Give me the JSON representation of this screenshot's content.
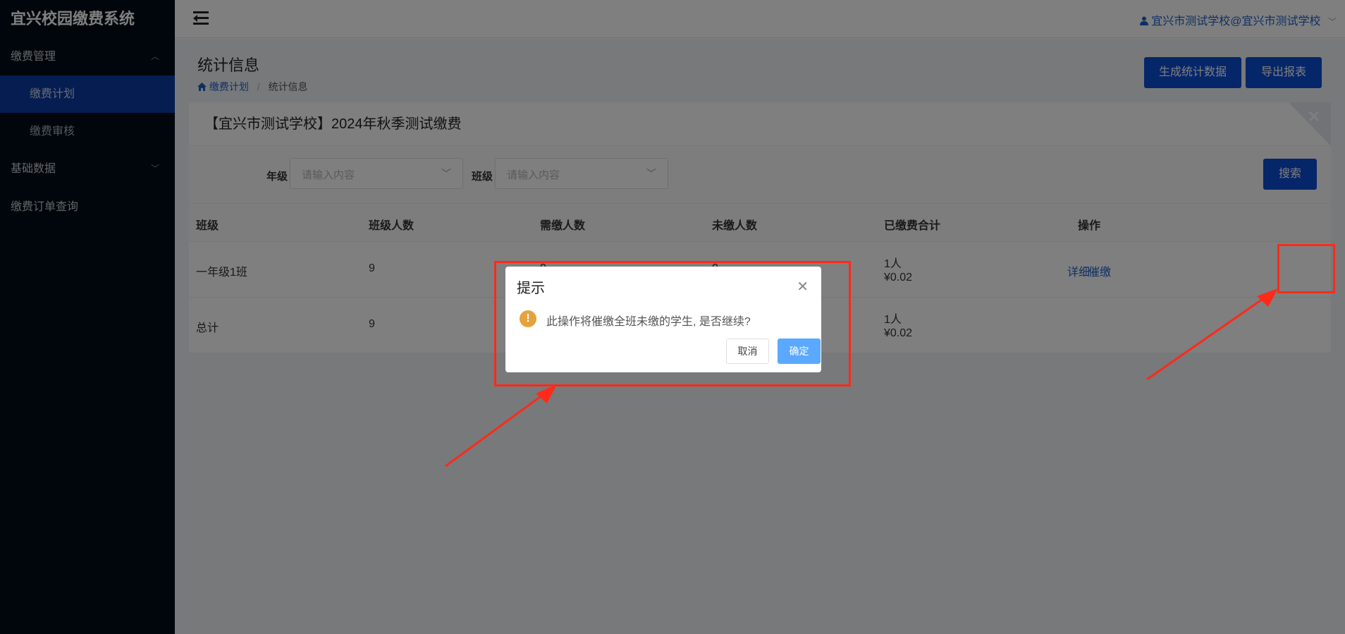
{
  "app": {
    "title": "宜兴校园缴费系统"
  },
  "sidebar": {
    "groups": [
      {
        "label": "缴费管理",
        "chevron": "︿"
      },
      {
        "label": "基础数据",
        "chevron": "﹀"
      }
    ],
    "sub_items": [
      "缴费计划",
      "缴费审核"
    ],
    "plain_item": "缴费订单查询"
  },
  "header": {
    "user_label": "宜兴市测试学校@宜兴市测试学校",
    "user_icon": "user-icon"
  },
  "page": {
    "title": "统计信息",
    "breadcrumb": {
      "home": "缴费计划",
      "current": "统计信息",
      "sep": "/"
    },
    "buttons": {
      "generate": "生成统计数据",
      "export": "导出报表"
    }
  },
  "card": {
    "title": "【宜兴市测试学校】2024年秋季测试缴费"
  },
  "filters": {
    "grade_label": "年级",
    "grade_placeholder": "请输入内容",
    "class_label": "班级",
    "class_placeholder": "请输入内容",
    "search_button": "搜索"
  },
  "table": {
    "headers": [
      "班级",
      "班级人数",
      "需缴人数",
      "未缴人数",
      "已缴费合计",
      "操作"
    ],
    "rows": [
      {
        "class": "一年级1班",
        "count": "9",
        "need": "0",
        "unpaid": "0",
        "paid_people": "1人",
        "paid_amount": "¥0.02",
        "action_detail": "详细",
        "action_remind": "催缴"
      },
      {
        "class": "总计",
        "count": "9",
        "need": "",
        "unpaid": "",
        "paid_people": "1人",
        "paid_amount": "¥0.02"
      }
    ]
  },
  "dialog": {
    "title": "提示",
    "message": "此操作将催缴全班未缴的学生, 是否继续?",
    "cancel": "取消",
    "confirm": "确定"
  },
  "colors": {
    "sidebar_bg": "#000c17",
    "primary": "#0c4dd4",
    "annotation_red": "#ff2a1a",
    "warning": "#e6a23c"
  }
}
